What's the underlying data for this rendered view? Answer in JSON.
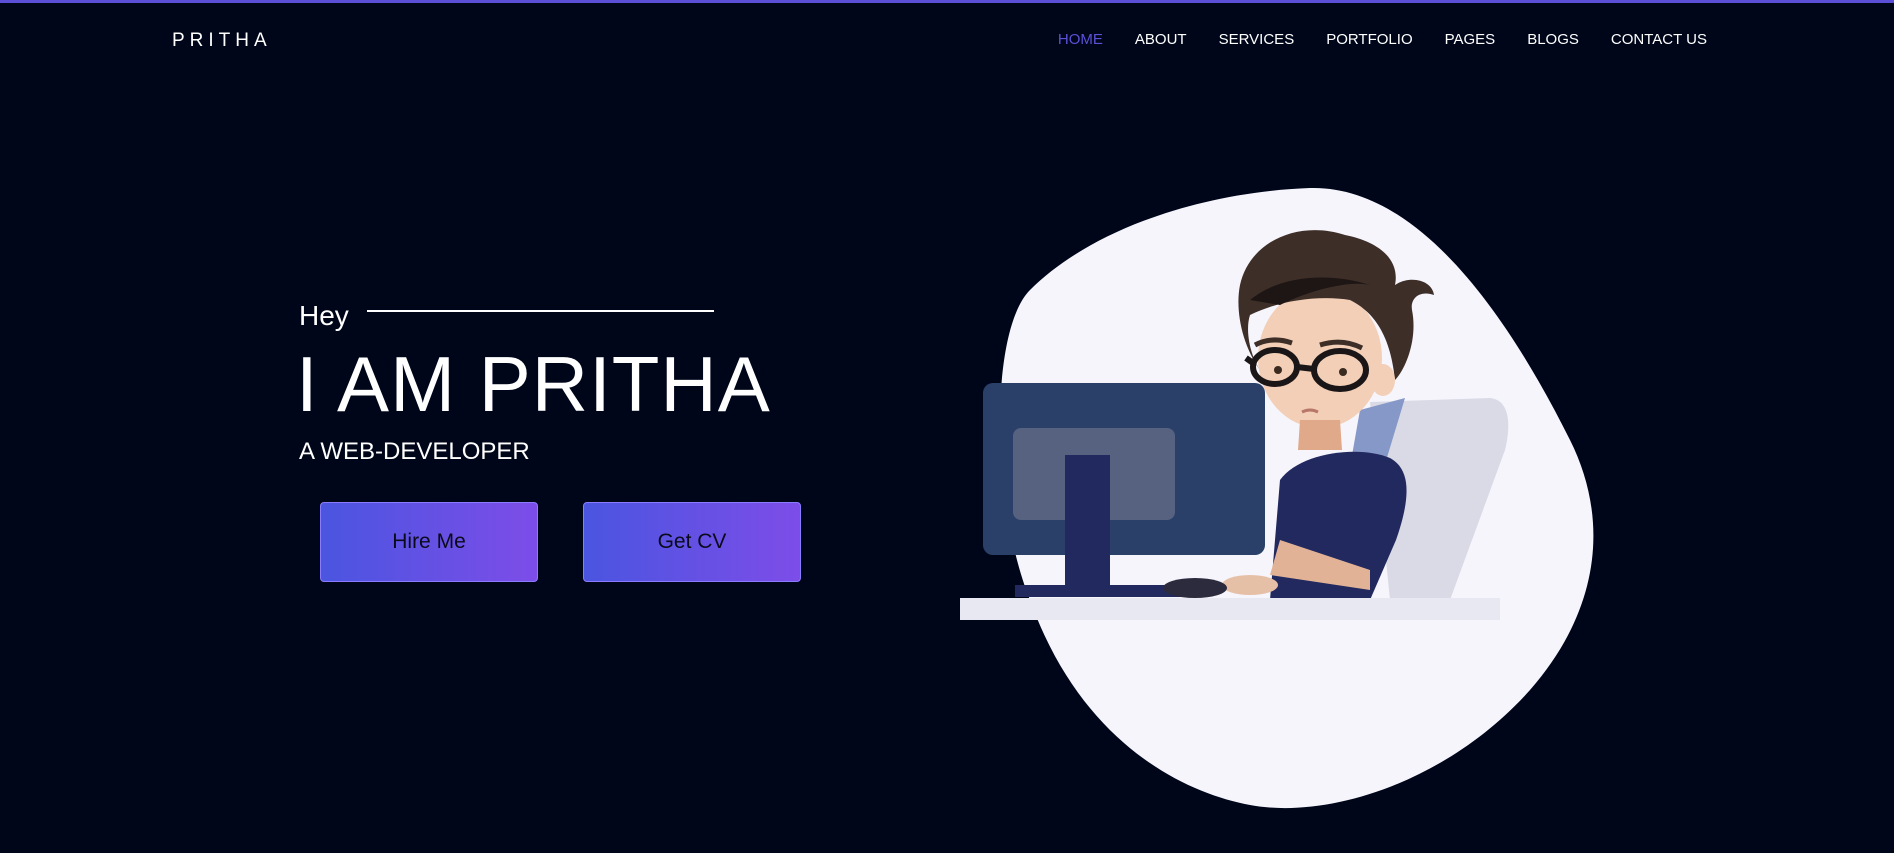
{
  "brand": {
    "logo_text": "PRITHA"
  },
  "nav": {
    "items": [
      {
        "label": "HOME",
        "active": true
      },
      {
        "label": "ABOUT"
      },
      {
        "label": "SERVICES"
      },
      {
        "label": "PORTFOLIO"
      },
      {
        "label": "PAGES"
      },
      {
        "label": "BLOGS"
      },
      {
        "label": "CONTACT US"
      }
    ]
  },
  "hero": {
    "greeting": "Hey",
    "title": "I AM PRITHA",
    "subtitle": "A WEB-DEVELOPER",
    "hire_label": "Hire Me",
    "cv_label": "Get CV"
  },
  "colors": {
    "background": "#00061a",
    "accent": "#5b50d6",
    "button_gradient_start": "#4a55e0",
    "button_gradient_end": "#7d4de8",
    "blob": "#f6f5fc"
  }
}
